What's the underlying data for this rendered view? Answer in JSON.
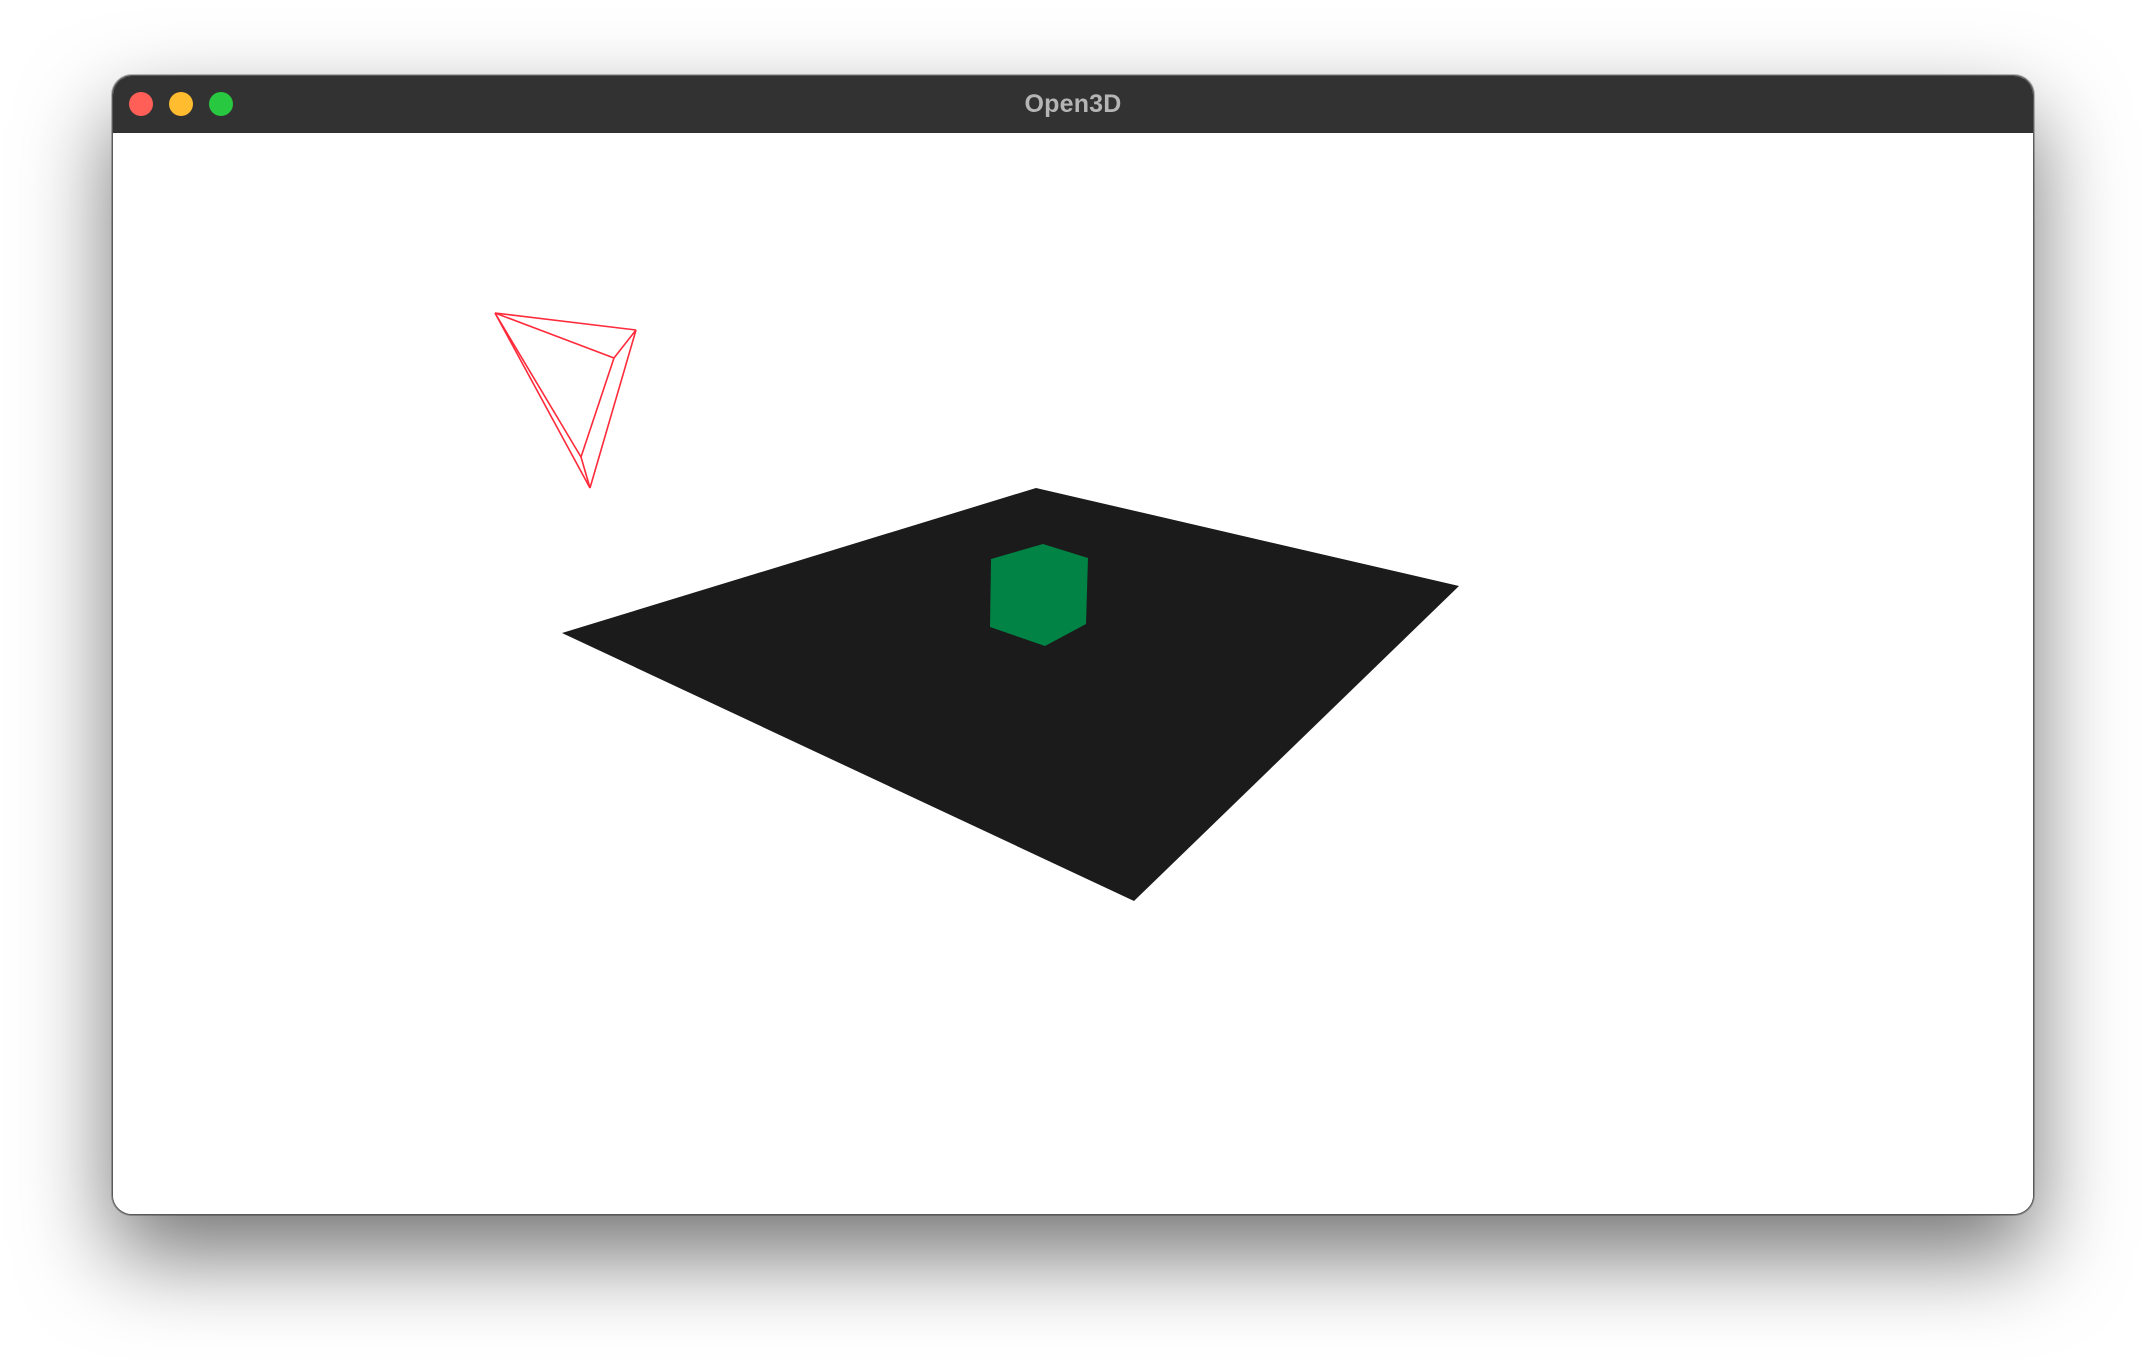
{
  "window": {
    "title": "Open3D"
  },
  "traffic_lights": {
    "close_color": "#ff5f57",
    "minimize_color": "#febc2e",
    "zoom_color": "#28c840"
  },
  "scene": {
    "background_color": "#ffffff",
    "ground_plane_color": "#1b1b1b",
    "cube_color": "#008344",
    "camera_frustum_color": "#ff2a3a"
  }
}
